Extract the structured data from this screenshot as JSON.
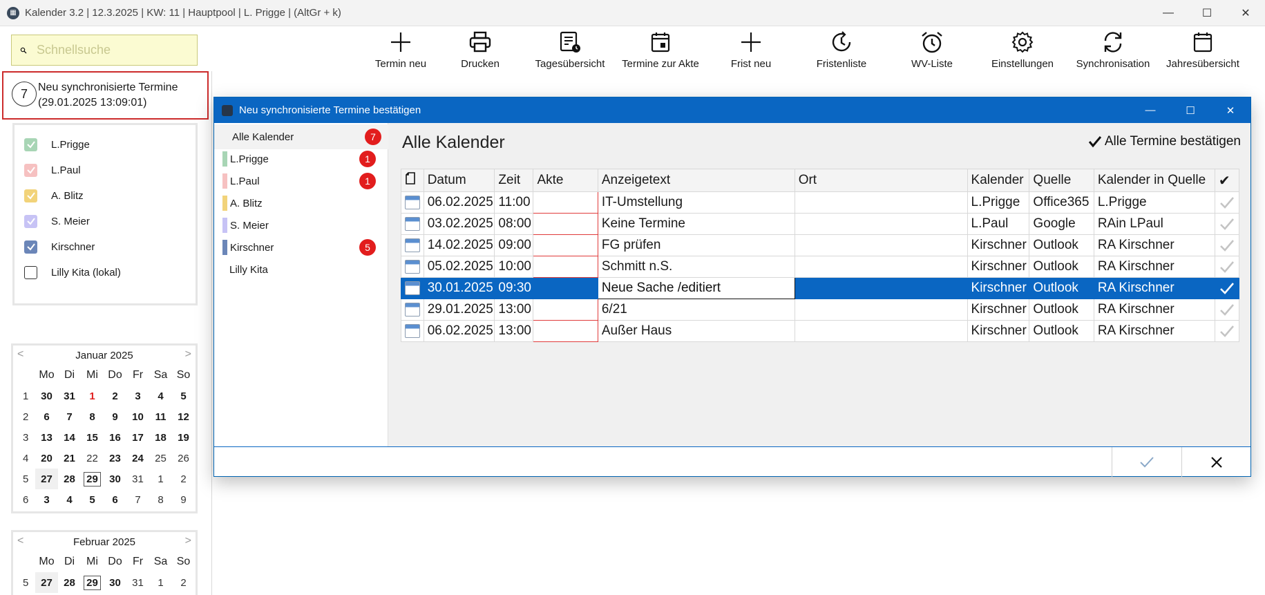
{
  "window": {
    "title": "Kalender 3.2 | 12.3.2025 | KW: 11 | Hauptpool | L. Prigge | (AltGr + k)",
    "minimize": "—",
    "maximize": "☐",
    "close": "✕"
  },
  "search": {
    "placeholder": "Schnellsuche",
    "icon": "search-icon"
  },
  "toolbar": [
    {
      "name": "termin-neu",
      "label": "Termin neu",
      "icon": "plus-icon"
    },
    {
      "name": "drucken",
      "label": "Drucken",
      "icon": "printer-icon"
    },
    {
      "name": "tagesuebersicht",
      "label": "Tagesübersicht",
      "icon": "day-overview-icon"
    },
    {
      "name": "termine-zur-akte",
      "label": "Termine zur Akte",
      "icon": "calendar-file-icon"
    },
    {
      "name": "frist-neu",
      "label": "Frist neu",
      "icon": "plus-icon"
    },
    {
      "name": "fristenliste",
      "label": "Fristenliste",
      "icon": "deadline-clock-icon"
    },
    {
      "name": "wv-liste",
      "label": "WV-Liste",
      "icon": "alarm-clock-icon"
    },
    {
      "name": "einstellungen",
      "label": "Einstellungen",
      "icon": "gear-icon"
    },
    {
      "name": "synchronisation",
      "label": "Synchronisation",
      "icon": "sync-icon"
    },
    {
      "name": "jahresuebersicht",
      "label": "Jahresübersicht",
      "icon": "calendar-icon"
    }
  ],
  "sync_notice": {
    "count": "7",
    "title": "Neu synchronisierte Termine",
    "date": "(29.01.2025 13:09:01)"
  },
  "calendars": [
    {
      "label": "L.Prigge",
      "checked": true,
      "color": "#a8d5b5"
    },
    {
      "label": "L.Paul",
      "checked": true,
      "color": "#f6c1c1"
    },
    {
      "label": "A. Blitz",
      "checked": true,
      "color": "#f2d37a"
    },
    {
      "label": "S. Meier",
      "checked": true,
      "color": "#c7c3f5"
    },
    {
      "label": "Kirschner",
      "checked": true,
      "color": "#6b86b8"
    },
    {
      "label": "Lilly Kita (lokal)",
      "checked": false,
      "color": "#ffffff"
    }
  ],
  "mini_calendars": [
    {
      "month": "Januar 2025",
      "prev": "<",
      "next": ">",
      "dow": [
        "Mo",
        "Di",
        "Mi",
        "Do",
        "Fr",
        "Sa",
        "So"
      ],
      "weeks": [
        {
          "no": "1",
          "days": [
            "30",
            "31",
            "1",
            "2",
            "3",
            "4",
            "5"
          ]
        },
        {
          "no": "2",
          "days": [
            "6",
            "7",
            "8",
            "9",
            "10",
            "11",
            "12"
          ]
        },
        {
          "no": "3",
          "days": [
            "13",
            "14",
            "15",
            "16",
            "17",
            "18",
            "19"
          ]
        },
        {
          "no": "4",
          "days": [
            "20",
            "21",
            "22",
            "23",
            "24",
            "25",
            "26"
          ]
        },
        {
          "no": "5",
          "days": [
            "27",
            "28",
            "29",
            "30",
            "31",
            "1",
            "2"
          ]
        },
        {
          "no": "6",
          "days": [
            "3",
            "4",
            "5",
            "6",
            "7",
            "8",
            "9"
          ]
        }
      ]
    },
    {
      "month": "Februar 2025",
      "prev": "<",
      "next": ">",
      "dow": [
        "Mo",
        "Di",
        "Mi",
        "Do",
        "Fr",
        "Sa",
        "So"
      ],
      "weeks": [
        {
          "no": "5",
          "days": [
            "27",
            "28",
            "29",
            "30",
            "31",
            "1",
            "2"
          ]
        }
      ]
    }
  ],
  "dialog": {
    "title": "Neu synchronisierte Termine bestätigen",
    "heading": "Alle Kalender",
    "confirm_all": "Alle Termine bestätigen",
    "sidebar": [
      {
        "label": "Alle Kalender",
        "badge": "7",
        "color": ""
      },
      {
        "label": "L.Prigge",
        "badge": "1",
        "color": "#a8d5b5"
      },
      {
        "label": "L.Paul",
        "badge": "1",
        "color": "#f6c1c1"
      },
      {
        "label": "A. Blitz",
        "badge": "",
        "color": "#f2d37a"
      },
      {
        "label": "S. Meier",
        "badge": "",
        "color": "#c7c3f5"
      },
      {
        "label": "Kirschner",
        "badge": "5",
        "color": "#6b86b8"
      },
      {
        "label": "Lilly Kita",
        "badge": "",
        "color": ""
      }
    ],
    "columns": [
      "",
      "Datum",
      "Zeit",
      "Akte",
      "Anzeigetext",
      "Ort",
      "Kalender",
      "Quelle",
      "Kalender in Quelle",
      "✔"
    ],
    "rows": [
      {
        "datum": "06.02.2025",
        "zeit": "11:00",
        "akte": "",
        "anzeigetext": "IT-Umstellung",
        "ort": "",
        "kalender": "L.Prigge",
        "quelle": "Office365",
        "kalender_quelle": "L.Prigge",
        "selected": false
      },
      {
        "datum": "03.02.2025",
        "zeit": "08:00",
        "akte": "",
        "anzeigetext": "Keine Termine",
        "ort": "",
        "kalender": "L.Paul",
        "quelle": "Google",
        "kalender_quelle": "RAin LPaul",
        "selected": false
      },
      {
        "datum": "14.02.2025",
        "zeit": "09:00",
        "akte": "",
        "anzeigetext": "FG prüfen",
        "ort": "",
        "kalender": "Kirschner",
        "quelle": "Outlook",
        "kalender_quelle": "RA Kirschner",
        "selected": false
      },
      {
        "datum": "05.02.2025",
        "zeit": "10:00",
        "akte": "",
        "anzeigetext": "Schmitt n.S.",
        "ort": "",
        "kalender": "Kirschner",
        "quelle": "Outlook",
        "kalender_quelle": "RA Kirschner",
        "selected": false
      },
      {
        "datum": "30.01.2025",
        "zeit": "09:30",
        "akte": "",
        "anzeigetext": "Neue Sache /editiert",
        "ort": "",
        "kalender": "Kirschner",
        "quelle": "Outlook",
        "kalender_quelle": "RA Kirschner",
        "selected": true
      },
      {
        "datum": "29.01.2025",
        "zeit": "13:00",
        "akte": "",
        "anzeigetext": "6/21",
        "ort": "",
        "kalender": "Kirschner",
        "quelle": "Outlook",
        "kalender_quelle": "RA Kirschner",
        "selected": false
      },
      {
        "datum": "06.02.2025",
        "zeit": "13:00",
        "akte": "",
        "anzeigetext": "Außer Haus",
        "ort": "",
        "kalender": "Kirschner",
        "quelle": "Outlook",
        "kalender_quelle": "RA Kirschner",
        "selected": false
      }
    ],
    "colors": {
      "accent": "#0a66c2",
      "badge": "#e21d1d",
      "akte_border": "#e03a3a"
    }
  }
}
